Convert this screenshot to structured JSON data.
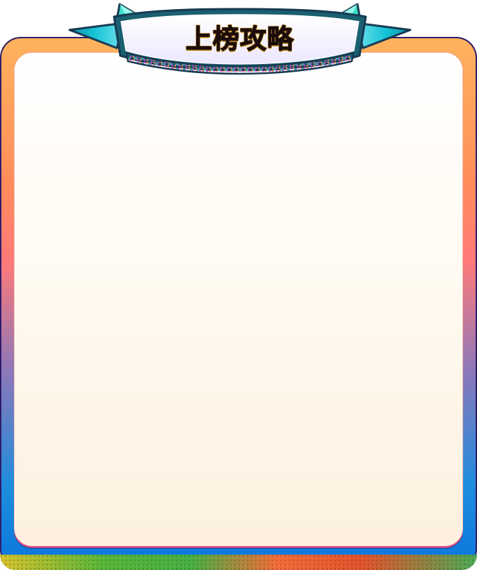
{
  "banner": {
    "title": "上榜攻略"
  },
  "colors": {
    "frame_top": "#ffb35d",
    "frame_middle": "#ff7a79",
    "frame_bottom": "#0b76dd",
    "panel_top": "#fffefe",
    "panel_bottom": "#fdf0df",
    "banner_primary": "#12b9cc",
    "banner_dark": "#174b5e",
    "banner_light": "#f7f4ff",
    "title_text": "#1b0d0d",
    "title_outline": "#c28d1b"
  },
  "icons": {
    "left_ribbon": "left-ribbon-icon",
    "right_ribbon": "right-ribbon-icon",
    "left_triangle": "triangle-icon",
    "right_triangle": "triangle-icon"
  }
}
